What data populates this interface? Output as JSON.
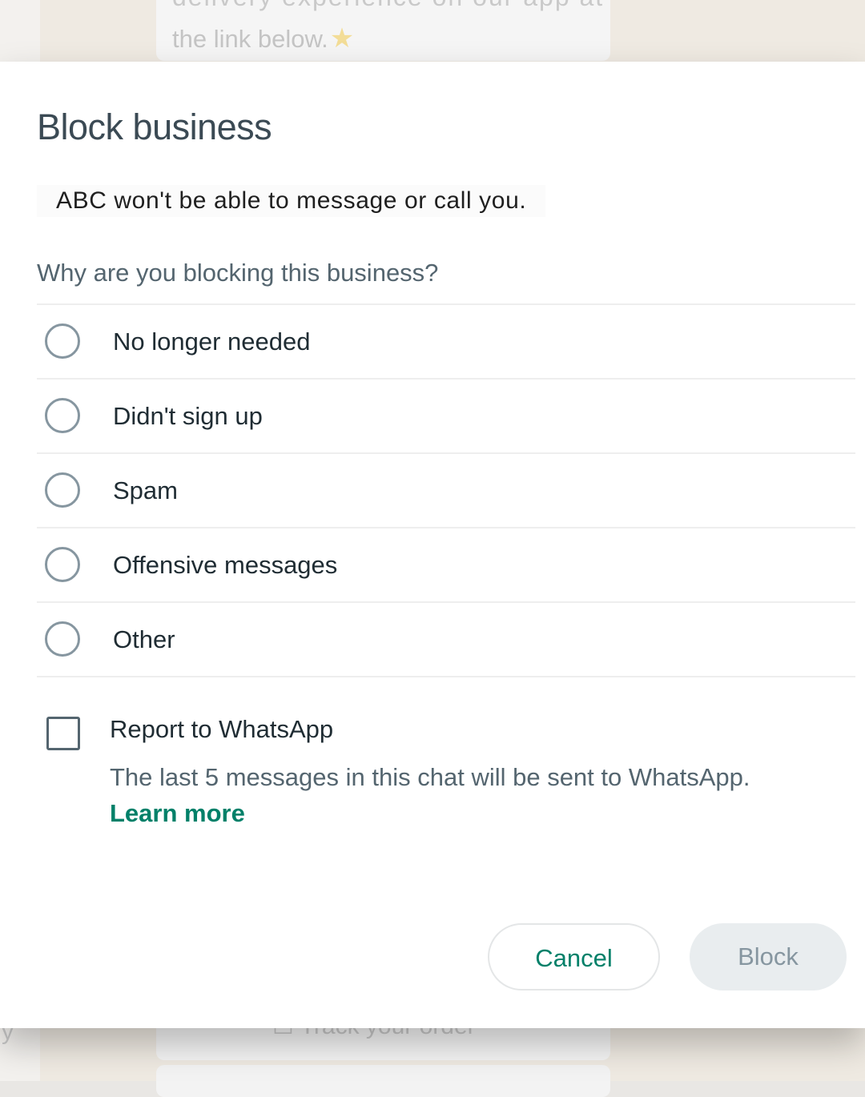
{
  "background": {
    "top_text_partial": "delivery experience on our app at",
    "top_text": "the link below.",
    "top_icon": "star-icon",
    "bottom_text": "Track your order",
    "bottom_icon": "box-icon",
    "left_char": "y"
  },
  "dialog": {
    "title": "Block business",
    "subtitle": "ABC won't be able to message or call you.",
    "question": "Why are you blocking this business?",
    "options": [
      {
        "label": "No longer needed",
        "selected": false
      },
      {
        "label": "Didn't sign up",
        "selected": false
      },
      {
        "label": "Spam",
        "selected": false
      },
      {
        "label": "Offensive messages",
        "selected": false
      },
      {
        "label": "Other",
        "selected": false
      }
    ],
    "report": {
      "label": "Report to WhatsApp",
      "checked": false,
      "description": "The last 5 messages in this chat will be sent to WhatsApp.",
      "learn_more": "Learn more"
    },
    "buttons": {
      "cancel": "Cancel",
      "block": "Block",
      "block_enabled": false
    }
  },
  "colors": {
    "accent": "#008069",
    "title": "#3b4a54",
    "secondary": "#54656f",
    "radio_border": "#8696a0",
    "disabled_bg": "#e9edef"
  }
}
